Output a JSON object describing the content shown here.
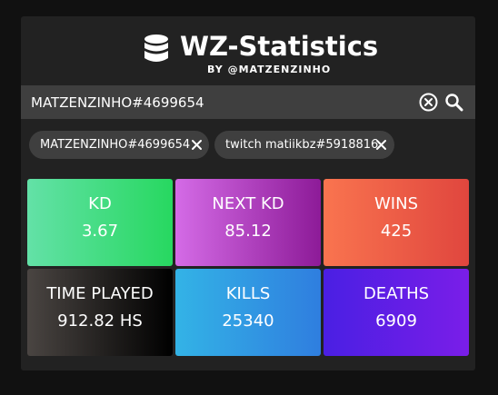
{
  "header": {
    "title": "WZ-Statistics",
    "subtitle": "BY @MATZENZINHO"
  },
  "search": {
    "value": "MATZENZINHO#4699654",
    "placeholder": ""
  },
  "chips": [
    {
      "label": "MATZENZINHO#4699654"
    },
    {
      "label": "twitch matiikbz#5918816"
    }
  ],
  "stats": [
    {
      "label": "KD",
      "value": "3.67"
    },
    {
      "label": "NEXT KD",
      "value": "85.12"
    },
    {
      "label": "WINS",
      "value": "425"
    },
    {
      "label": "TIME PLAYED",
      "value": "912.82 HS"
    },
    {
      "label": "KILLS",
      "value": "25340"
    },
    {
      "label": "DEATHS",
      "value": "6909"
    }
  ],
  "colors": {
    "background": "#111111",
    "panel": "#222222",
    "search_bg": "#3f3f3f",
    "kd": [
      "#63e1a7",
      "#27d860"
    ],
    "next_kd": [
      "#d46be6",
      "#8d1b98"
    ],
    "wins": [
      "#f9744f",
      "#e0463e"
    ],
    "time_played": [
      "#4a4542",
      "#000000"
    ],
    "kills": [
      "#33b3e6",
      "#2f7edf"
    ],
    "deaths": [
      "#4a1fe3",
      "#7a1ee8"
    ]
  },
  "icons": {
    "logo": "database-icon",
    "clear": "clear-circle-icon",
    "search": "search-icon",
    "chip_remove": "close-icon"
  }
}
